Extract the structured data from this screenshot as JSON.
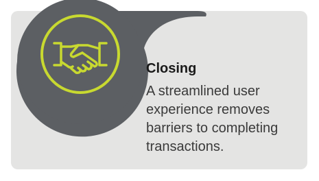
{
  "card": {
    "title": "Closing",
    "description": "A streamlined user experience removes barriers to completing transactions."
  },
  "icon": {
    "name": "handshake-icon"
  },
  "colors": {
    "card_background": "#e4e4e3",
    "circle_fill": "#5c5f63",
    "icon_accent": "#c8d930",
    "title_text": "#1a1a1a",
    "body_text": "#3a3a3a"
  }
}
